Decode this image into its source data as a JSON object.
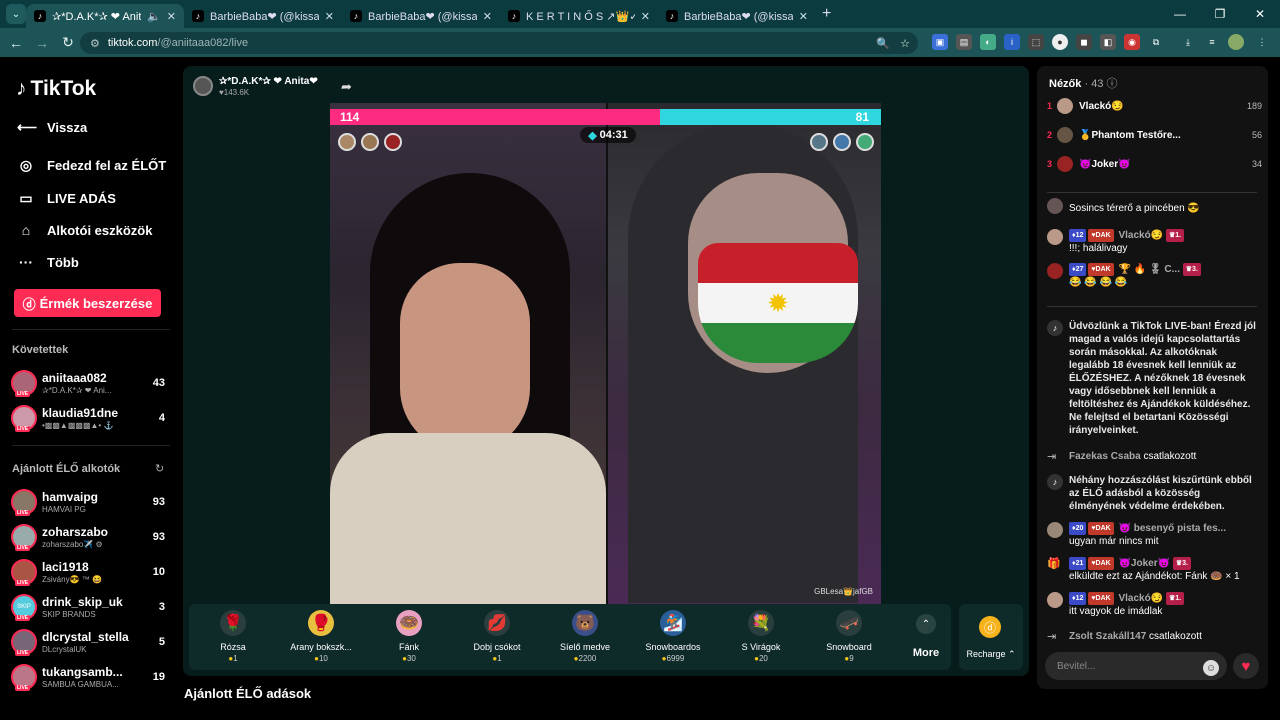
{
  "browser": {
    "tabs": [
      {
        "title": "✰*D.A.K*✰ ❤ Anita❤",
        "icon": "tiktok-icon"
      },
      {
        "title": "BarbieBaba❤ (@kissabarbie) |",
        "icon": "tiktok-icon"
      },
      {
        "title": "BarbieBaba❤ (@kissabarbie) |",
        "icon": "tiktok-icon"
      },
      {
        "title": "K E R T I N Ő S ↗👑✓ (@",
        "icon": "tiktok-icon"
      },
      {
        "title": "BarbieBaba❤ (@kissabarbie) |",
        "icon": "tiktok-icon"
      }
    ],
    "url_host": "tiktok.com",
    "url_path": "/@aniitaaa082/live"
  },
  "sidebar": {
    "logo": "TikTok",
    "nav": [
      {
        "label": "Vissza",
        "icon": "back-arrow-icon"
      },
      {
        "label": "Fedezd fel az ÉLŐT",
        "icon": "live-explore-icon"
      },
      {
        "label": "LIVE ADÁS",
        "icon": "camera-icon"
      },
      {
        "label": "Alkotói eszközök",
        "icon": "house-icon"
      },
      {
        "label": "Több",
        "icon": "more-dots-icon"
      }
    ],
    "coins_button": "Érmék beszerzése",
    "following_title": "Követettek",
    "following": [
      {
        "name": "aniitaaa082",
        "sub": "✰*D.A.K*✰ ❤ Ani...",
        "count": "43"
      },
      {
        "name": "klaudia91dne",
        "sub": "•▩▩▲▩▩▩▲• ⚓",
        "count": "4"
      }
    ],
    "recommended_title": "Ajánlott ÉLŐ alkotók",
    "recommended": [
      {
        "name": "hamvaipg",
        "sub": "HAMVAI PG",
        "count": "93"
      },
      {
        "name": "zoharszabo",
        "sub": "zoharszabo✈️ ⚙",
        "count": "93"
      },
      {
        "name": "laci1918",
        "sub": "Zsivány😎 ™ 😆",
        "count": "10"
      },
      {
        "name": "drink_skip_uk",
        "sub": "SKIP BRANDS",
        "count": "3"
      },
      {
        "name": "dlcrystal_stella",
        "sub": "DLcrystalUK",
        "count": "5"
      },
      {
        "name": "tukangsamb...",
        "sub": "SAMBUA GAMBUA...",
        "count": "19"
      }
    ]
  },
  "stream": {
    "host_name": "✰*D.A.K*✰ ❤ Anita❤",
    "host_likes": "♥143.6K",
    "score_left": "114",
    "score_right": "81",
    "timer": "04:31",
    "watermark": "GBLesa👑jafGB",
    "recommended_title": "Ajánlott ÉLŐ adások"
  },
  "gifts": [
    {
      "name": "Rózsa",
      "price": "1",
      "icon": "🌹",
      "color": "#2a3f3d"
    },
    {
      "name": "Arany bokszk...",
      "price": "10",
      "icon": "🥊",
      "color": "#e8c040"
    },
    {
      "name": "Fánk",
      "price": "30",
      "icon": "🍩",
      "color": "#e8a0c0"
    },
    {
      "name": "Dobj csókot",
      "price": "1",
      "icon": "💋",
      "color": "#2a3f3d"
    },
    {
      "name": "Síelő medve",
      "price": "2200",
      "icon": "🐻",
      "color": "#3a4f8a"
    },
    {
      "name": "Snowboardos",
      "price": "6999",
      "icon": "🏂",
      "color": "#2a5f9a"
    },
    {
      "name": "S Virágok",
      "price": "20",
      "icon": "💐",
      "color": "#2a3f3d"
    },
    {
      "name": "Snowboard",
      "price": "9",
      "icon": "🛹",
      "color": "#2a3f3d"
    }
  ],
  "more_label": "More",
  "recharge_label": "Recharge",
  "chat": {
    "viewers_label": "Nézők",
    "viewers_count": "· 43",
    "top_viewers": [
      {
        "rank": "1",
        "name": "Vlackó😏",
        "score": "189"
      },
      {
        "rank": "2",
        "name": "🥇Phantom Testőre...",
        "score": "56"
      },
      {
        "rank": "3",
        "name": "😈Joker😈",
        "score": "34"
      }
    ],
    "messages": [
      {
        "user": "",
        "text": "Sosincs térerő a pincében 😎"
      },
      {
        "user": "Vlackó😏",
        "lvl": "12",
        "fan": "DAK",
        "rank": "1.",
        "text": "!!!; halálivagy"
      },
      {
        "user": "🏆 🔥 🎖 C...",
        "lvl": "27",
        "fan": "DAK",
        "rank": "3.",
        "text": "😂 😂 😂 😂"
      },
      {
        "user": "",
        "text": "Üdvözlünk a TikTok LIVE-ban! Érezd jól magad a valós idejű kapcsolattartás során másokkal. Az alkotóknak legalább 18 évesnek kell lenniük az ÉLŐZÉSHEZ. A nézőknek 18 évesnek vagy idősebbnek kell lenniük a feltöltéshez és Ajándékok küldéséhez. Ne felejtsd el betartani Közösségi irányelveinket."
      },
      {
        "user": "Fazekas Csaba",
        "text": "csatlakozott"
      },
      {
        "user": "",
        "text": "Néhány hozzászólást kiszűrtünk ebből az ÉLŐ adásból a közösség élményének védelme érdekében."
      },
      {
        "user": "😈 besenyő pista fes...",
        "lvl": "20",
        "fan": "DAK",
        "text": "ugyan már nincs mit"
      },
      {
        "user": "😈Joker😈",
        "lvl": "21",
        "fan": "DAK",
        "rank": "3.",
        "text": "elküldte ezt az Ajándékot: Fánk 🍩 × 1"
      },
      {
        "user": "Vlackó😏",
        "lvl": "12",
        "fan": "DAK",
        "rank": "1.",
        "text": "itt vagyok de imádlak"
      },
      {
        "user": "Zsolt Szakáll147",
        "text": "csatlakozott"
      }
    ],
    "input_placeholder": "Bevitel..."
  }
}
